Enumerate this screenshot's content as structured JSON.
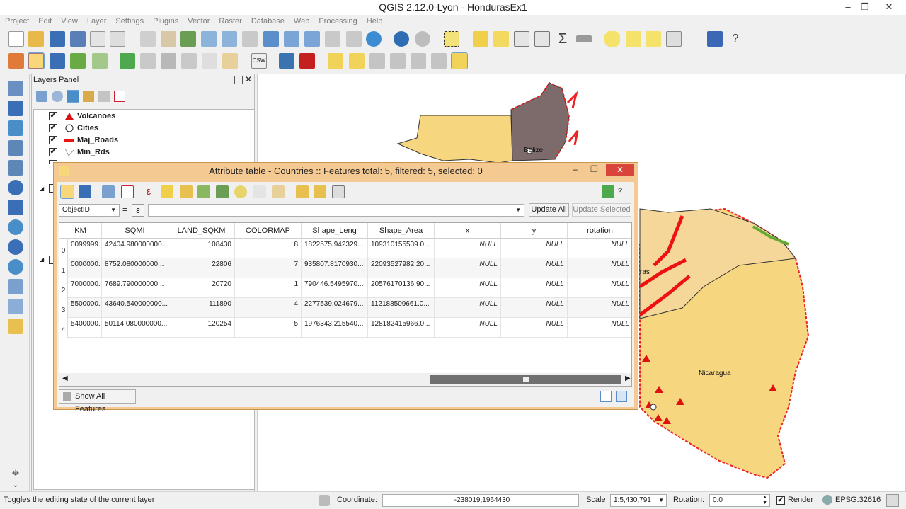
{
  "window": {
    "title": "QGIS 2.12.0-Lyon - HondurasEx1",
    "minimize": "–",
    "restore": "❐",
    "close": "✕"
  },
  "menu": [
    "Project",
    "Edit",
    "View",
    "Layer",
    "Settings",
    "Plugins",
    "Vector",
    "Raster",
    "Database",
    "Web",
    "Processing",
    "Help"
  ],
  "layers_panel": {
    "title": "Layers Panel",
    "layers": [
      {
        "name": "Volcanoes",
        "checked": "✔"
      },
      {
        "name": "Cities",
        "checked": "✔"
      },
      {
        "name": "Maj_Roads",
        "checked": "✔"
      },
      {
        "name": "Min_Rds",
        "checked": "✔"
      }
    ]
  },
  "map": {
    "labels": {
      "belize": "Belize",
      "nicaragua": "Nicaragua",
      "honduras_partial": "ras"
    }
  },
  "attribute_table": {
    "title": "Attribute table - Countries :: Features total: 5, filtered: 5, selected: 0",
    "field_select": "ObjectID",
    "equals": "=",
    "expr_symbol": "ε",
    "update_all": "Update All",
    "update_selected": "Update Selected",
    "columns": [
      "KM",
      "SQMI",
      "LAND_SQKM",
      "COLORMAP",
      "Shape_Leng",
      "Shape_Area",
      "x",
      "y",
      "rotation"
    ],
    "rows": [
      {
        "id": "0",
        "cells": [
          "0099999...",
          "42404.980000000...",
          "108430",
          "8",
          "1822575.942329...",
          "109310155539.0...",
          "NULL",
          "NULL",
          "NULL"
        ]
      },
      {
        "id": "1",
        "cells": [
          "0000000...",
          "8752.080000000...",
          "22806",
          "7",
          "935807.8170930...",
          "22093527982.20...",
          "NULL",
          "NULL",
          "NULL"
        ]
      },
      {
        "id": "2",
        "cells": [
          "7000000...",
          "7689.790000000...",
          "20720",
          "1",
          "790446.5495970...",
          "20576170136.90...",
          "NULL",
          "NULL",
          "NULL"
        ]
      },
      {
        "id": "3",
        "cells": [
          "5500000...",
          "43640.540000000...",
          "111890",
          "4",
          "2277539.024679...",
          "112188509661.0...",
          "NULL",
          "NULL",
          "NULL"
        ]
      },
      {
        "id": "4",
        "cells": [
          "5400000...",
          "50114.080000000...",
          "120254",
          "5",
          "1976343.215540...",
          "128182415966.0...",
          "NULL",
          "NULL",
          "NULL"
        ]
      }
    ],
    "show_features": "Show All Features",
    "help": "?"
  },
  "status": {
    "message": "Toggles the editing state of the current layer",
    "coordinate_label": "Coordinate:",
    "coordinate": "-238019,1964430",
    "scale_label": "Scale",
    "scale": "1:5,430,791",
    "rotation_label": "Rotation:",
    "rotation": "0.0",
    "render_label": "Render",
    "render_checked": "✔",
    "crs": "EPSG:32616"
  }
}
